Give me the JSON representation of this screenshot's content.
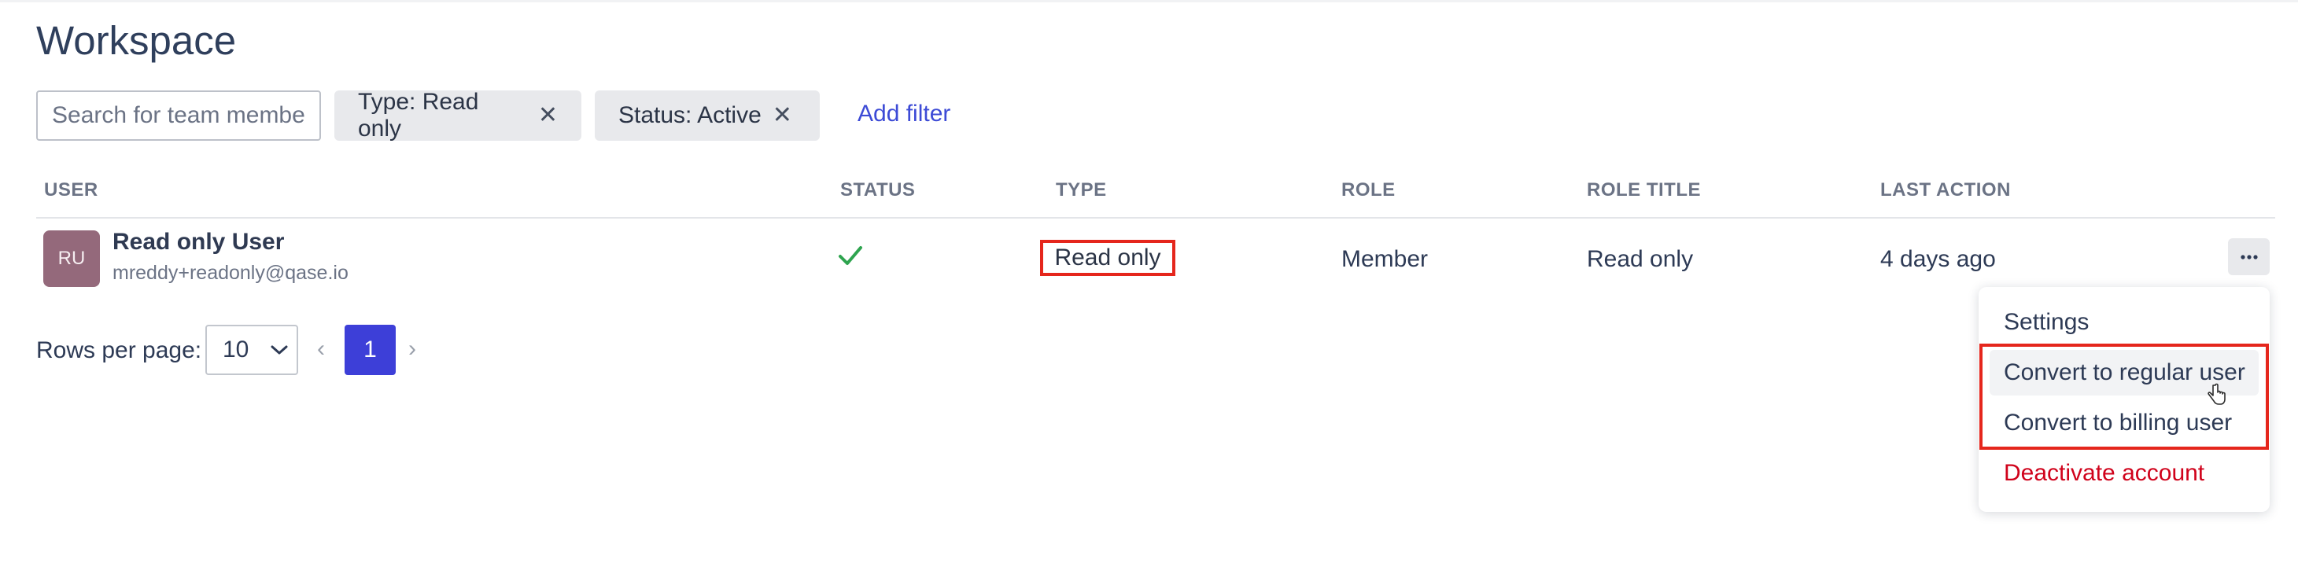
{
  "page": {
    "title": "Workspace"
  },
  "filters": {
    "search_placeholder": "Search for team members",
    "chips": [
      {
        "label": "Type: Read only",
        "remove_icon": "close-icon"
      },
      {
        "label": "Status: Active",
        "remove_icon": "close-icon"
      }
    ],
    "add_filter_label": "Add filter"
  },
  "table": {
    "columns": [
      "USER",
      "STATUS",
      "TYPE",
      "ROLE",
      "ROLE TITLE",
      "LAST ACTION"
    ],
    "rows": [
      {
        "avatar_initials": "RU",
        "name": "Read only User",
        "email": "mreddy+readonly@qase.io",
        "status_icon": "check-icon",
        "type": "Read only",
        "role": "Member",
        "role_title": "Read only",
        "last_action": "4 days ago",
        "actions_icon": "more-horizontal-icon"
      }
    ]
  },
  "pagination": {
    "rows_per_page_label": "Rows per page:",
    "rows_per_page_value": "10",
    "prev_symbol": "‹",
    "next_symbol": "›",
    "current_page": "1"
  },
  "row_menu": {
    "items": [
      "Settings",
      "Convert to regular user",
      "Convert to billing user",
      "Deactivate account"
    ]
  },
  "colors": {
    "accent": "#3d3fd8",
    "link": "#3d4bd6",
    "danger": "#d0021b",
    "success": "#2ea44f",
    "highlight_box": "#e5261c",
    "avatar_bg": "#94697b"
  }
}
